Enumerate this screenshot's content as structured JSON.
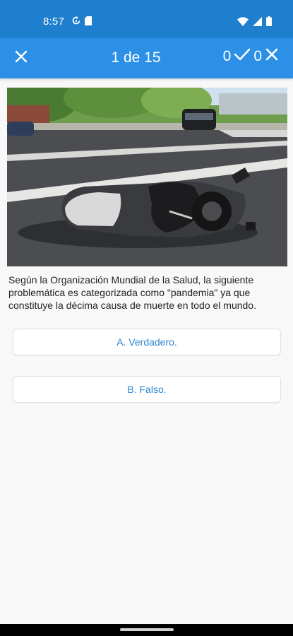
{
  "status_bar": {
    "time": "8:57",
    "left_icons": [
      "sync-icon",
      "sim-card-icon"
    ],
    "right_icons": [
      "wifi-icon",
      "signal-icon",
      "battery-icon"
    ]
  },
  "app_bar": {
    "close_icon": "close-icon",
    "progress": "1 de 15",
    "correct_count": "0",
    "wrong_count": "0",
    "accent_color": "#2b90e6"
  },
  "photo": {
    "subject": "motorcycle-on-road"
  },
  "question": {
    "text": "Según la Organización Mundial de la Salud, la siguiente problemática es categorizada como \"pandemia\" ya que constituye la décima causa de muerte en todo el mundo."
  },
  "answers": [
    {
      "label": "A. Verdadero."
    },
    {
      "label": "B. Falso."
    }
  ],
  "colors": {
    "status_bar": "#1f7fcf",
    "app_bar": "#2b90e6",
    "answer_text": "#2c83cf",
    "background": "#f8f8f8"
  }
}
